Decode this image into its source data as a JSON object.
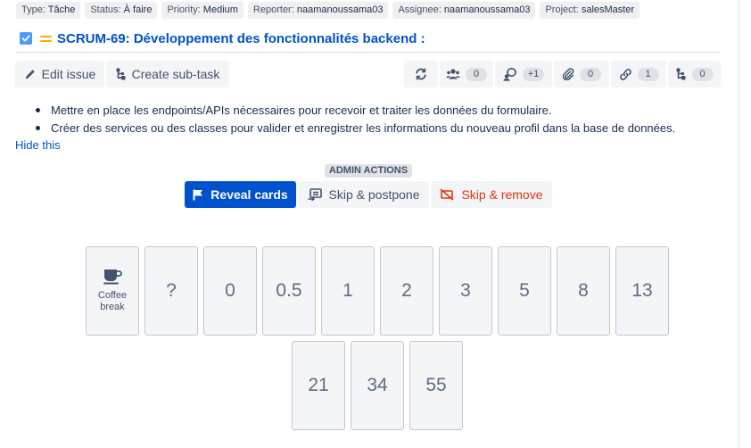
{
  "meta": [
    {
      "key": "Type:",
      "value": "Tâche"
    },
    {
      "key": "Status:",
      "value": "À faire"
    },
    {
      "key": "Priority:",
      "value": "Medium"
    },
    {
      "key": "Reporter:",
      "value": "naamanoussama03"
    },
    {
      "key": "Assignee:",
      "value": "naamanoussama03"
    },
    {
      "key": "Project:",
      "value": "salesMaster"
    }
  ],
  "issue": {
    "title": "SCRUM-69: Développement des fonctionnalités backend :",
    "checkbox_color": "#4c9aff",
    "priority_color": "#ffab00"
  },
  "toolbar": {
    "edit_label": "Edit issue",
    "subtask_label": "Create sub-task",
    "refresh_icon": "refresh-icon",
    "counters": [
      {
        "icon": "users-icon",
        "count": "0"
      },
      {
        "icon": "voters-icon",
        "count": "+1"
      },
      {
        "icon": "attachment-icon",
        "count": "0"
      },
      {
        "icon": "link-icon",
        "count": "1"
      },
      {
        "icon": "subtask-icon",
        "count": "0"
      }
    ]
  },
  "description": {
    "items": [
      "Mettre en place les endpoints/APIs nécessaires pour recevoir et traiter les données du formulaire.",
      "Créer des services ou des classes pour valider et enregistrer les informations du nouveau profil dans la base de données."
    ],
    "hide_label": "Hide this"
  },
  "admin": {
    "label": "ADMIN ACTIONS",
    "reveal_label": "Reveal cards",
    "postpone_label": "Skip & postpone",
    "remove_label": "Skip & remove",
    "reveal_color": "#0052cc",
    "remove_color": "#de350b"
  },
  "cards": {
    "coffee_label": "Coffee break",
    "values": [
      "?",
      "0",
      "0.5",
      "1",
      "2",
      "3",
      "5",
      "8",
      "13",
      "21",
      "34",
      "55"
    ]
  }
}
